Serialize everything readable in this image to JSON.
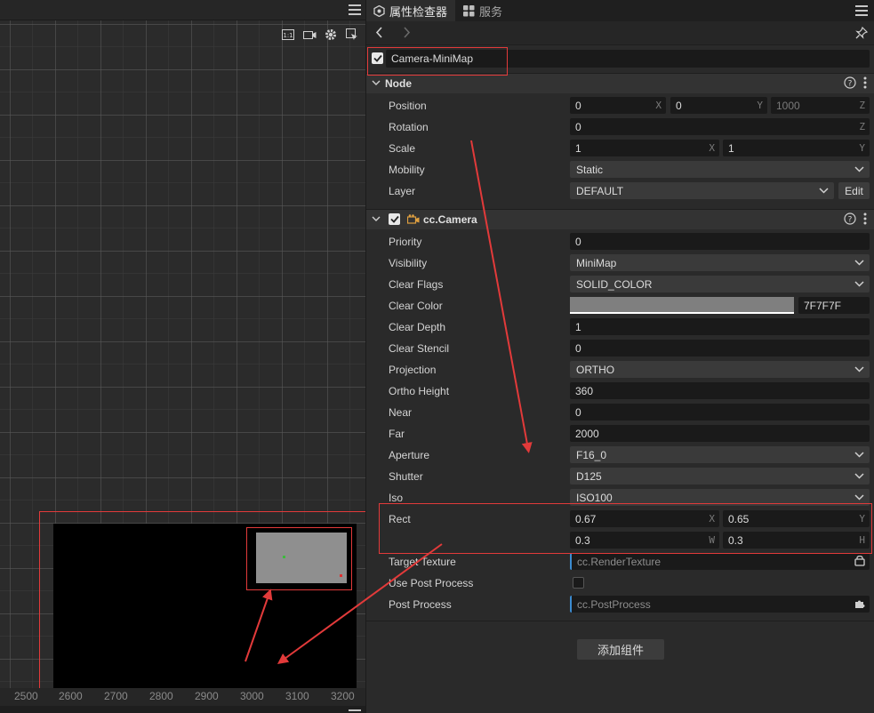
{
  "scene": {
    "ruler_labels": [
      "2500",
      "2600",
      "2700",
      "2800",
      "2900",
      "3000",
      "3100",
      "3200"
    ],
    "tool_icons": [
      "ratio-icon",
      "camera-icon",
      "gear-icon",
      "snap-icon"
    ]
  },
  "inspector": {
    "tabs": [
      {
        "label": "属性检查器",
        "icon": "inspector-icon",
        "active": true
      },
      {
        "label": "服务",
        "icon": "services-icon",
        "active": false
      }
    ],
    "node_name": "Camera-MiniMap",
    "node_enabled": true,
    "node_section": {
      "title": "Node",
      "position": {
        "label": "Position",
        "x": "0",
        "y": "0",
        "z": "1000"
      },
      "rotation": {
        "label": "Rotation",
        "z": "0"
      },
      "scale": {
        "label": "Scale",
        "x": "1",
        "y": "1"
      },
      "mobility": {
        "label": "Mobility",
        "value": "Static"
      },
      "layer": {
        "label": "Layer",
        "value": "DEFAULT",
        "edit": "Edit"
      }
    },
    "camera_section": {
      "title": "cc.Camera",
      "enabled": true,
      "priority": {
        "label": "Priority",
        "value": "0"
      },
      "visibility": {
        "label": "Visibility",
        "value": "MiniMap"
      },
      "clear_flags": {
        "label": "Clear Flags",
        "value": "SOLID_COLOR"
      },
      "clear_color": {
        "label": "Clear Color",
        "hex": "7F7F7F",
        "swatch": "#7f7f7f"
      },
      "clear_depth": {
        "label": "Clear Depth",
        "value": "1"
      },
      "clear_stencil": {
        "label": "Clear Stencil",
        "value": "0"
      },
      "projection": {
        "label": "Projection",
        "value": "ORTHO"
      },
      "ortho_height": {
        "label": "Ortho Height",
        "value": "360"
      },
      "near": {
        "label": "Near",
        "value": "0"
      },
      "far": {
        "label": "Far",
        "value": "2000"
      },
      "aperture": {
        "label": "Aperture",
        "value": "F16_0"
      },
      "shutter": {
        "label": "Shutter",
        "value": "D125"
      },
      "iso": {
        "label": "Iso",
        "value": "ISO100"
      },
      "rect": {
        "label": "Rect",
        "x": "0.67",
        "y": "0.65",
        "w": "0.3",
        "h": "0.3"
      },
      "target_texture": {
        "label": "Target Texture",
        "value": "cc.RenderTexture"
      },
      "use_post_process": {
        "label": "Use Post Process",
        "checked": false
      },
      "post_process": {
        "label": "Post Process",
        "value": "cc.PostProcess"
      }
    },
    "add_component": "添加组件"
  },
  "axis_letters": {
    "x": "X",
    "y": "Y",
    "z": "Z",
    "w": "W",
    "h": "H"
  },
  "colors": {
    "annotation": "#e23a3a",
    "asset_accent": "#3b8bd0"
  }
}
